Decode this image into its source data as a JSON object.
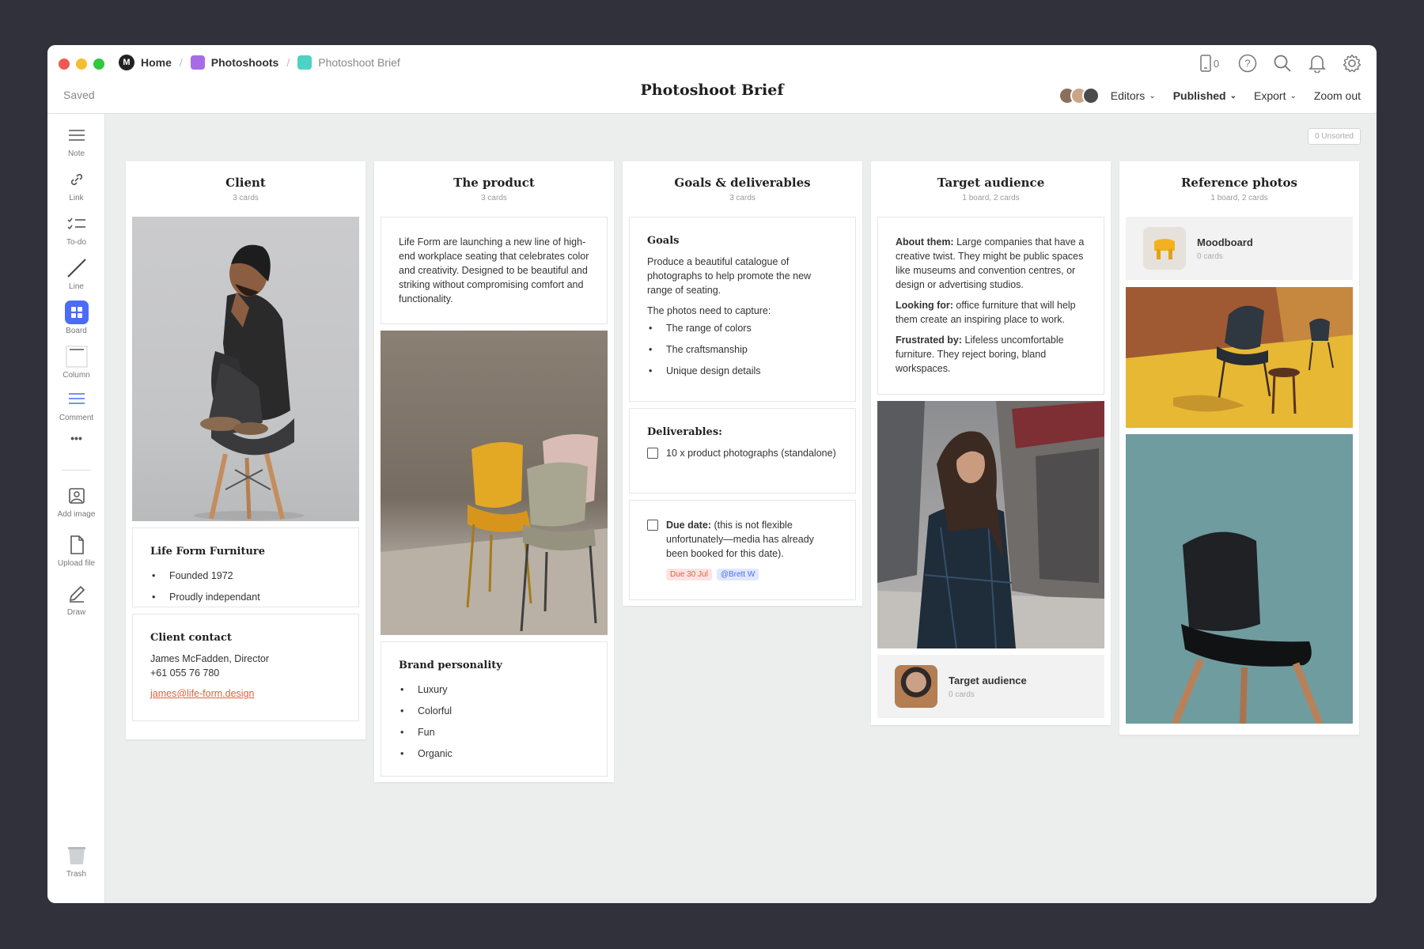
{
  "window": {
    "breadcrumbs": [
      {
        "label": "Home",
        "color": "#222222"
      },
      {
        "label": "Photoshoots",
        "color": "#a76be8"
      },
      {
        "label": "Photoshoot Brief",
        "color": "#4fd1c5"
      }
    ],
    "saved_status": "Saved",
    "title": "Photoshoot Brief",
    "device_count": "0",
    "actions": {
      "editors": "Editors",
      "published": "Published",
      "export": "Export",
      "zoom_out": "Zoom out"
    }
  },
  "sidebar": {
    "tools": [
      {
        "label": "Note",
        "icon": "note-icon"
      },
      {
        "label": "Link",
        "icon": "link-icon"
      },
      {
        "label": "To-do",
        "icon": "todo-icon"
      },
      {
        "label": "Line",
        "icon": "line-icon"
      },
      {
        "label": "Board",
        "icon": "board-icon"
      },
      {
        "label": "Column",
        "icon": "column-icon"
      },
      {
        "label": "Comment",
        "icon": "comment-icon"
      },
      {
        "label": "Add image",
        "icon": "add-image-icon"
      },
      {
        "label": "Upload file",
        "icon": "upload-file-icon"
      },
      {
        "label": "Draw",
        "icon": "draw-icon"
      },
      {
        "label": "Trash",
        "icon": "trash-icon"
      }
    ]
  },
  "unsorted": "0 Unsorted",
  "columns": {
    "client": {
      "title": "Client",
      "sub": "3 cards",
      "company_title": "Life Form Furniture",
      "company_items": [
        "Founded 1972",
        "Proudly independant"
      ],
      "contact_title": "Client contact",
      "contact_name": "James McFadden, Director",
      "contact_phone": "+61 055 76 780",
      "contact_email": "james@life-form.design"
    },
    "product": {
      "title": "The product",
      "sub": "3 cards",
      "description": "Life Form are launching a new line of high-end workplace seating that celebrates color and creativity. Designed to be beautiful and striking without compromising comfort and functionality.",
      "brand_title": "Brand personality",
      "brand_items": [
        "Luxury",
        "Colorful",
        "Fun",
        "Organic"
      ]
    },
    "goals": {
      "title": "Goals & deliverables",
      "sub": "3 cards",
      "goals_title": "Goals",
      "goals_text": "Produce a beautiful catalogue of photographs to help promote the new range of seating.",
      "capture_intro": "The photos need to capture:",
      "capture_items": [
        "The range of colors",
        "The craftsmanship",
        "Unique design details"
      ],
      "deliverables_title": "Deliverables:",
      "deliverable_item": "10 x product photographs (standalone)",
      "due_label": "Due date:",
      "due_text": "(this is not flexible unfortunately—media has already been booked for this date).",
      "due_tag": "Due 30 Jul",
      "mention_tag": "@Brett W"
    },
    "audience": {
      "title": "Target audience",
      "sub": "1 board, 2 cards",
      "about_label": "About them:",
      "about_text": "Large companies that have a creative twist. They might be public spaces like museums and convention centres, or design or advertising studios.",
      "looking_label": "Looking for:",
      "looking_text": "office furniture that will help them create an inspiring place to work.",
      "frustrated_label": "Frustrated by:",
      "frustrated_text": "Lifeless uncomfortable furniture. They reject boring, bland workspaces.",
      "board_title": "Target audience",
      "board_sub": "0 cards"
    },
    "reference": {
      "title": "Reference photos",
      "sub": "1 board, 2 cards",
      "board_title": "Moodboard",
      "board_sub": "0 cards"
    }
  },
  "colors": {
    "accent": "#4a6cf7",
    "link": "#e0623e",
    "due_tag_bg": "#fde3e3",
    "mention_tag_bg": "#e1e8fd"
  }
}
